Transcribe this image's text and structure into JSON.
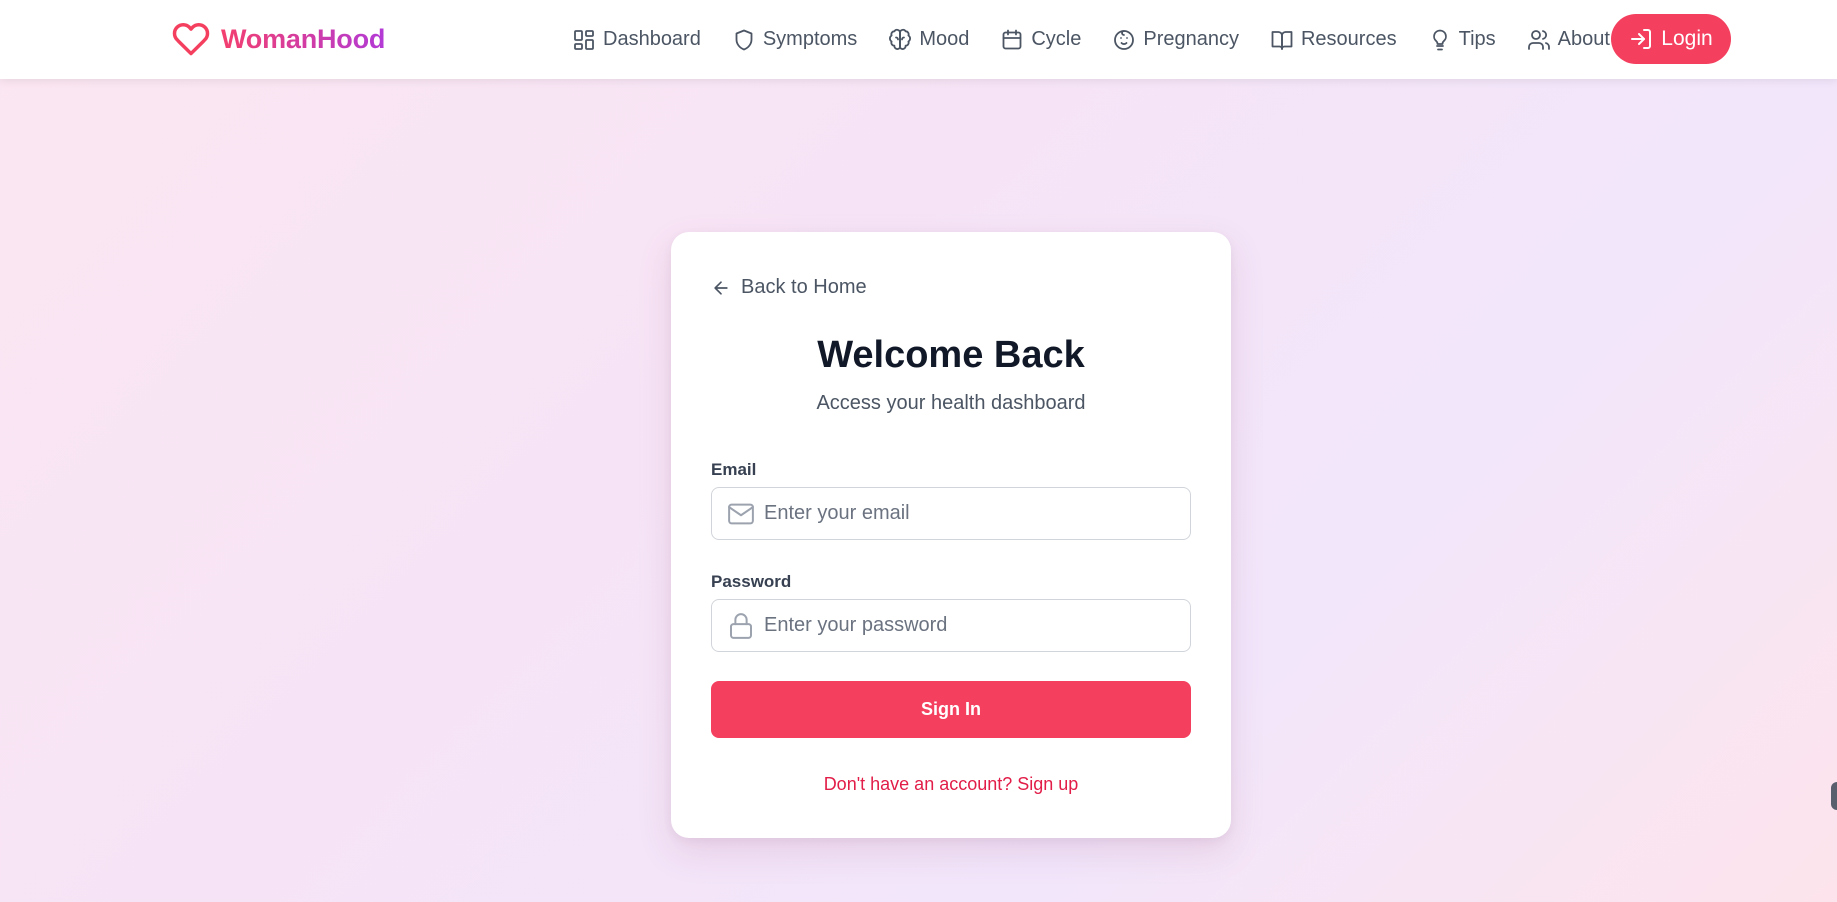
{
  "brand": {
    "name": "WomanHood",
    "logo_icon": "heart-icon",
    "colors": {
      "primary": "#f43f5e",
      "gradient_end": "#b23ad6"
    }
  },
  "nav": {
    "items": [
      {
        "label": "Dashboard",
        "icon": "dashboard-icon"
      },
      {
        "label": "Symptoms",
        "icon": "shield-icon"
      },
      {
        "label": "Mood",
        "icon": "brain-icon"
      },
      {
        "label": "Cycle",
        "icon": "calendar-icon"
      },
      {
        "label": "Pregnancy",
        "icon": "baby-icon"
      },
      {
        "label": "Resources",
        "icon": "book-icon"
      },
      {
        "label": "Tips",
        "icon": "lightbulb-icon"
      },
      {
        "label": "About",
        "icon": "users-icon"
      }
    ],
    "login_label": "Login",
    "login_icon": "login-icon"
  },
  "login_card": {
    "back_label": "Back to Home",
    "title": "Welcome Back",
    "subtitle": "Access your health dashboard",
    "email": {
      "label": "Email",
      "placeholder": "Enter your email",
      "value": "",
      "icon": "mail-icon"
    },
    "password": {
      "label": "Password",
      "placeholder": "Enter your password",
      "value": "",
      "icon": "lock-icon"
    },
    "submit_label": "Sign In",
    "signup_prompt": "Don't have an account? Sign up"
  }
}
